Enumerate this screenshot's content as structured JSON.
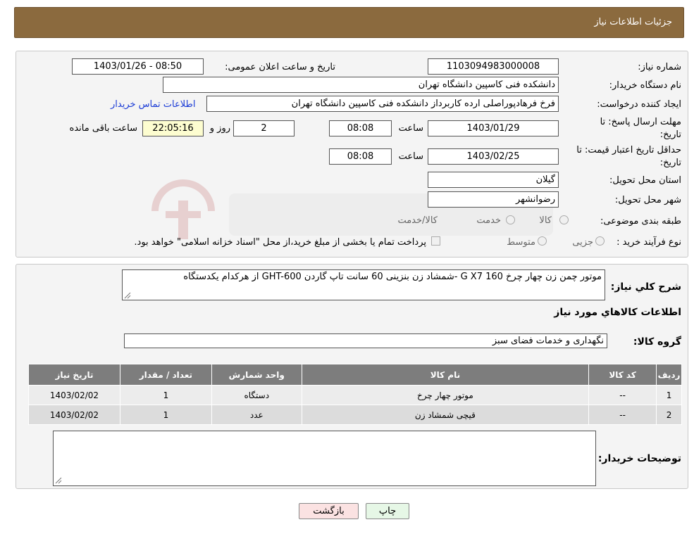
{
  "header": {
    "title": "جزئیات اطلاعات نیاز"
  },
  "form": {
    "need_number_label": "شماره نیاز:",
    "need_number": "1103094983000008",
    "announce_label": "تاریخ و ساعت اعلان عمومی:",
    "announce_value": "1403/01/26 - 08:50",
    "buyer_org_label": "نام دستگاه خریدار:",
    "buyer_org": "دانشکده فنی کاسپین دانشگاه تهران",
    "creator_label": "ایجاد کننده درخواست:",
    "creator": "فرخ فرهادپوراصلی ارده کاربرداز دانشکده فنی کاسپین دانشگاه تهران",
    "contact_link": "اطلاعات تماس خریدار",
    "deadline_label_1": "مهلت ارسال پاسخ: تا",
    "deadline_label_2": "تاریخ:",
    "deadline_date": "1403/01/29",
    "time_label": "ساعت",
    "deadline_time": "08:08",
    "days_value": "2",
    "days_label": "روز و",
    "remaining_time": "22:05:16",
    "remaining_label": "ساعت باقی مانده",
    "validity_label_1": "حداقل تاریخ اعتبار قیمت: تا",
    "validity_label_2": "تاریخ:",
    "validity_date": "1403/02/25",
    "validity_time": "08:08",
    "province_label": "استان محل تحویل:",
    "province": "گیلان",
    "city_label": "شهر محل تحویل:",
    "city": "رضوانشهر",
    "category_label": "طبقه بندی موضوعی:",
    "category_options": [
      "کالا",
      "خدمت",
      "کالا/خدمت"
    ],
    "process_label": "نوع فرآیند خرید :",
    "process_options": [
      "جزیی",
      "متوسط"
    ],
    "process_note": "پرداخت تمام یا بخشی از مبلغ خرید،از محل \"اسناد خزانه اسلامی\" خواهد بود."
  },
  "details": {
    "summary_label": "شرح كلي نياز:",
    "summary": "موتور چمن زن چهار چرخ G X7 160 -شمشاد زن بنزینی 60 سانت تاپ گاردن GHT-600 از هرکدام یکدستگاه",
    "items_heading": "اطلاعات كالاهاي مورد نياز",
    "group_label": "گروه کالا:",
    "group": "نگهداری و خدمات فضای سبز",
    "buyer_notes_label": "توضیحات خریدار:"
  },
  "table": {
    "columns": [
      "ردیف",
      "کد کالا",
      "نام کالا",
      "واحد شمارش",
      "تعداد / مقدار",
      "تاریخ نیاز"
    ],
    "rows": [
      [
        "1",
        "--",
        "موتور چهار چرخ",
        "دستگاه",
        "1",
        "1403/02/02"
      ],
      [
        "2",
        "--",
        "قیچی شمشاد زن",
        "عدد",
        "1",
        "1403/02/02"
      ]
    ]
  },
  "buttons": {
    "print": "چاپ",
    "back": "بازگشت"
  },
  "colors": {
    "header": "#8b6a3e",
    "table_header": "#7d7d7d",
    "link": "#1a3bd6",
    "remaining_bg": "#fdfdd0"
  }
}
